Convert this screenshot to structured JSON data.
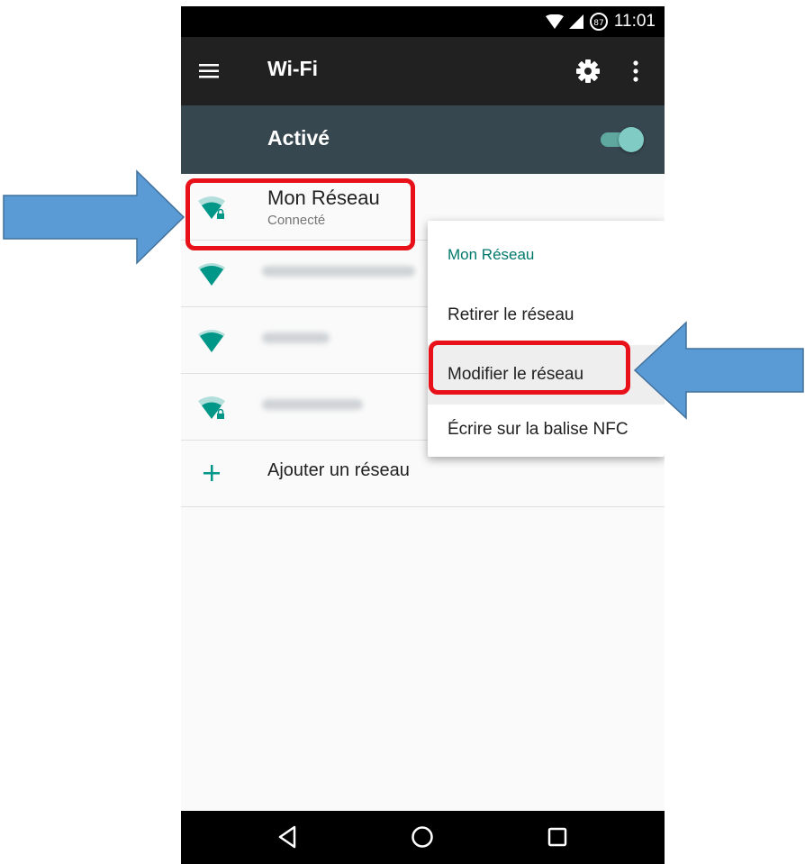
{
  "status_bar": {
    "time": "11:01",
    "battery_level": "87"
  },
  "toolbar": {
    "title": "Wi-Fi",
    "menu_icon": "hamburger-icon",
    "settings_icon": "gear-icon",
    "overflow_icon": "more-vert-icon"
  },
  "wifi_switch": {
    "label": "Activé",
    "enabled": true
  },
  "networks": [
    {
      "name": "Mon Réseau",
      "status": "Connecté",
      "secured": true
    },
    {
      "name_obscured": true,
      "secured": false
    },
    {
      "name_obscured": true,
      "secured": false
    },
    {
      "name_obscured": true,
      "secured": true
    }
  ],
  "add_network": {
    "label": "Ajouter un réseau"
  },
  "context_menu": {
    "title": "Mon Réseau",
    "items": [
      "Retirer le réseau",
      "Modifier le réseau",
      "Écrire sur la balise NFC"
    ],
    "highlighted_index": 1
  },
  "colors": {
    "accent": "#009688",
    "annotation_red": "#e8111a",
    "annotation_blue": "#5b9bd5"
  }
}
